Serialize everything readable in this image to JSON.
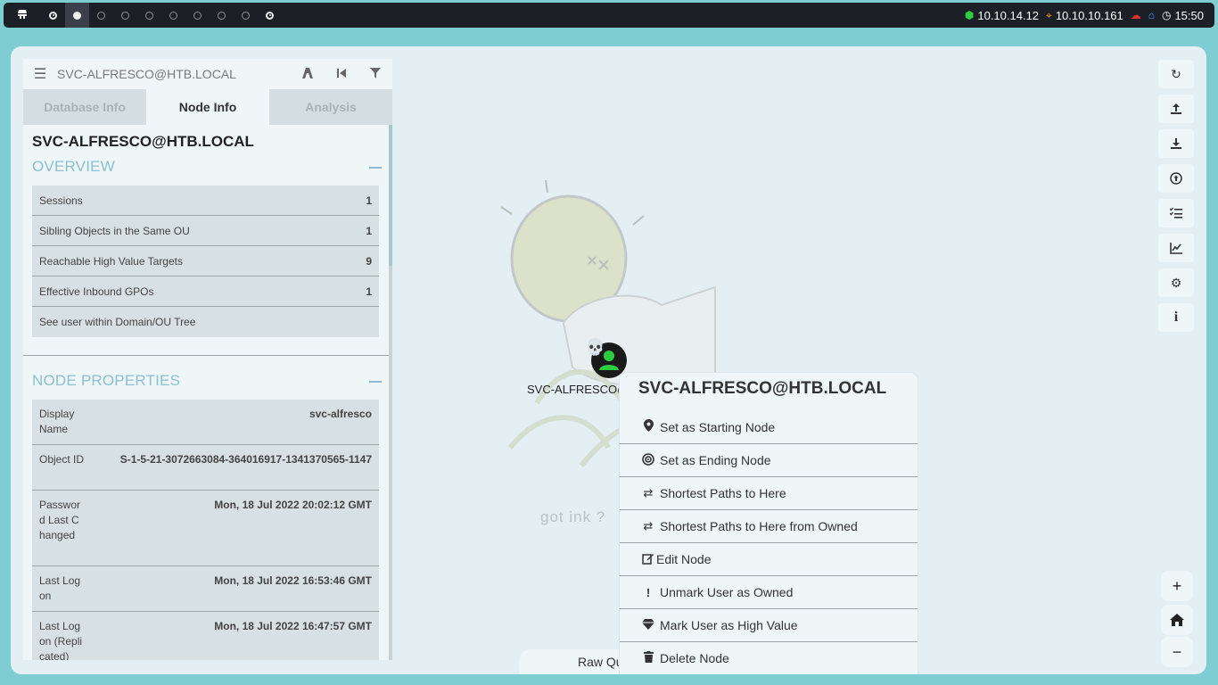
{
  "topbar": {
    "workspaces": [
      "1",
      "2",
      "3",
      "4",
      "5",
      "6",
      "7",
      "8",
      "9",
      "10"
    ],
    "ip_tun": "10.10.14.12",
    "ip_target": "10.10.10.161",
    "time": "15:50",
    "colors": {
      "tun_icon": "#2ecc40",
      "target_icon": "#f39c12",
      "cloud_icon": "#e03131",
      "home_icon": "#4aa3ff"
    }
  },
  "panel": {
    "header_title": "SVC-ALFRESCO@HTB.LOCAL",
    "tabs": [
      {
        "label": "Database Info",
        "active": false
      },
      {
        "label": "Node Info",
        "active": true
      },
      {
        "label": "Analysis",
        "active": false
      }
    ],
    "node_title": "SVC-ALFRESCO@HTB.LOCAL",
    "overview": {
      "title": "OVERVIEW",
      "rows": [
        {
          "label": "Sessions",
          "value": "1"
        },
        {
          "label": "Sibling Objects in the Same OU",
          "value": "1"
        },
        {
          "label": "Reachable High Value Targets",
          "value": "9"
        },
        {
          "label": "Effective Inbound GPOs",
          "value": "1"
        },
        {
          "label": "See user within Domain/OU Tree",
          "value": ""
        }
      ]
    },
    "node_properties": {
      "title": "NODE PROPERTIES",
      "rows": [
        {
          "label": "Display Name",
          "value": "svc-alfresco"
        },
        {
          "label": "Object ID",
          "value": "S-1-5-21-3072663084-364016917-1341370565-1147"
        },
        {
          "label": "Password Last Changed",
          "value": "Mon, 18 Jul 2022 20:02:12 GMT"
        },
        {
          "label": "Last Logon",
          "value": "Mon, 18 Jul 2022 16:53:46 GMT"
        },
        {
          "label": "Last Logon (Replicated)",
          "value": "Mon, 18 Jul 2022 16:47:57 GMT"
        }
      ]
    }
  },
  "graph": {
    "watermark_text": "got ink ?",
    "node_label": "SVC-ALFRESCO@",
    "node_color": "#2ecc40",
    "raw_query_label": "Raw Query"
  },
  "context_menu": {
    "title": "SVC-ALFRESCO@HTB.LOCAL",
    "items": [
      {
        "label": "Set as Starting Node",
        "icon": "map-marker-icon"
      },
      {
        "label": "Set as Ending Node",
        "icon": "target-icon"
      },
      {
        "label": "Shortest Paths to Here",
        "icon": "shuffle-icon"
      },
      {
        "label": "Shortest Paths to Here from Owned",
        "icon": "shuffle-icon"
      },
      {
        "label": "Edit Node",
        "icon": "edit-icon"
      },
      {
        "label": "Unmark User as Owned",
        "icon": "exclamation-icon"
      },
      {
        "label": "Mark User as High Value",
        "icon": "gem-icon"
      },
      {
        "label": "Delete Node",
        "icon": "trash-icon"
      }
    ]
  },
  "toolbar": {
    "buttons": [
      "refresh-icon",
      "upload-icon",
      "download-icon",
      "import-icon",
      "tasks-icon",
      "chart-icon",
      "settings-icon",
      "info-icon"
    ],
    "zoom": [
      "zoom-in-icon",
      "home-icon",
      "zoom-out-icon"
    ]
  }
}
